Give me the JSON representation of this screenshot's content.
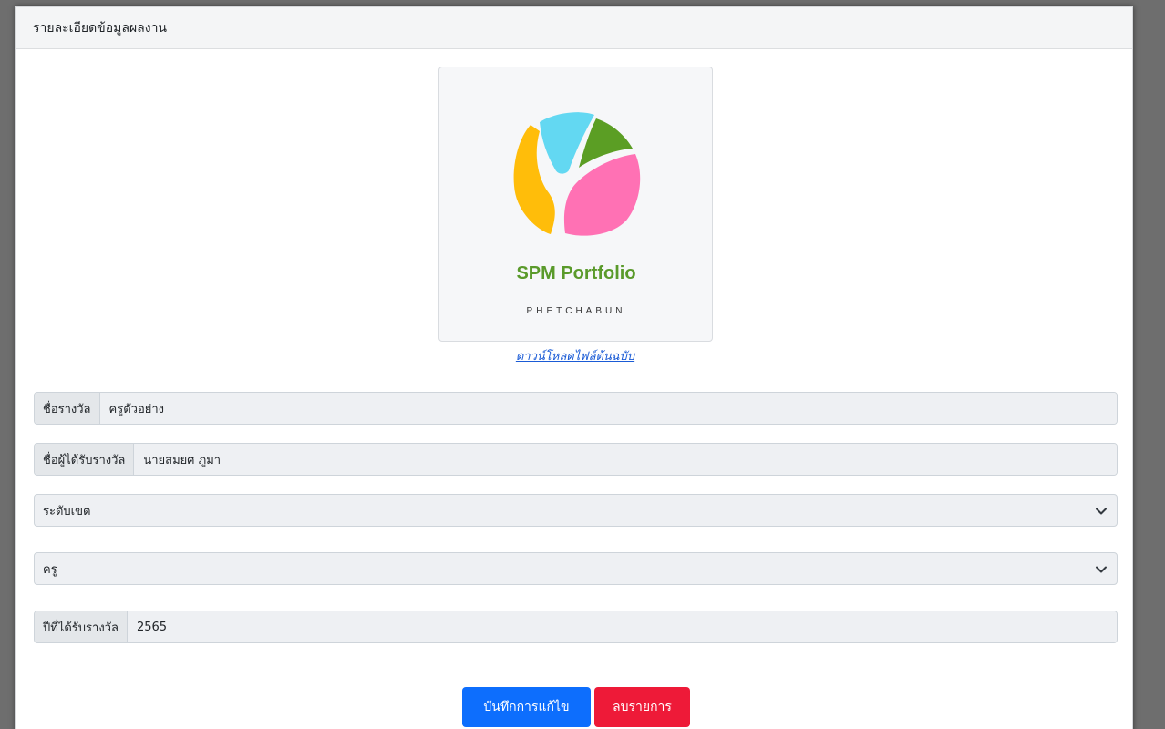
{
  "card": {
    "header_title": "รายละเอียดข้อมูลผลงาน"
  },
  "image": {
    "logo_title": "SPM Portfolio",
    "logo_subtitle": "PHETCHABUN",
    "logo_colors": {
      "cyan": "#63d8f2",
      "green": "#5b9e24",
      "yellow": "#ffbd0a",
      "pink": "#ff71b4",
      "text_green": "#5a9a2b"
    },
    "download_link": "ดาวน์โหลดไฟล์ต้นฉบับ"
  },
  "form": {
    "award_name": {
      "label": "ชื่อรางวัล",
      "value": "ครูตัวอย่าง"
    },
    "recipient": {
      "label": "ชื่อผู้ได้รับรางวัล",
      "value": "นายสมยศ ภูมา"
    },
    "level_select": {
      "value": "ระดับเขต",
      "icon": "chevron-down-icon"
    },
    "type_select": {
      "value": "ครู",
      "icon": "chevron-down-icon"
    },
    "year": {
      "label": "ปีที่ได้รับรางวัล",
      "value": "2565"
    }
  },
  "buttons": {
    "save_label": "บันทึกการแก้ไข",
    "delete_label": "ลบรายการ",
    "save_color": "#0d6efd",
    "delete_color": "#ee1a38"
  }
}
